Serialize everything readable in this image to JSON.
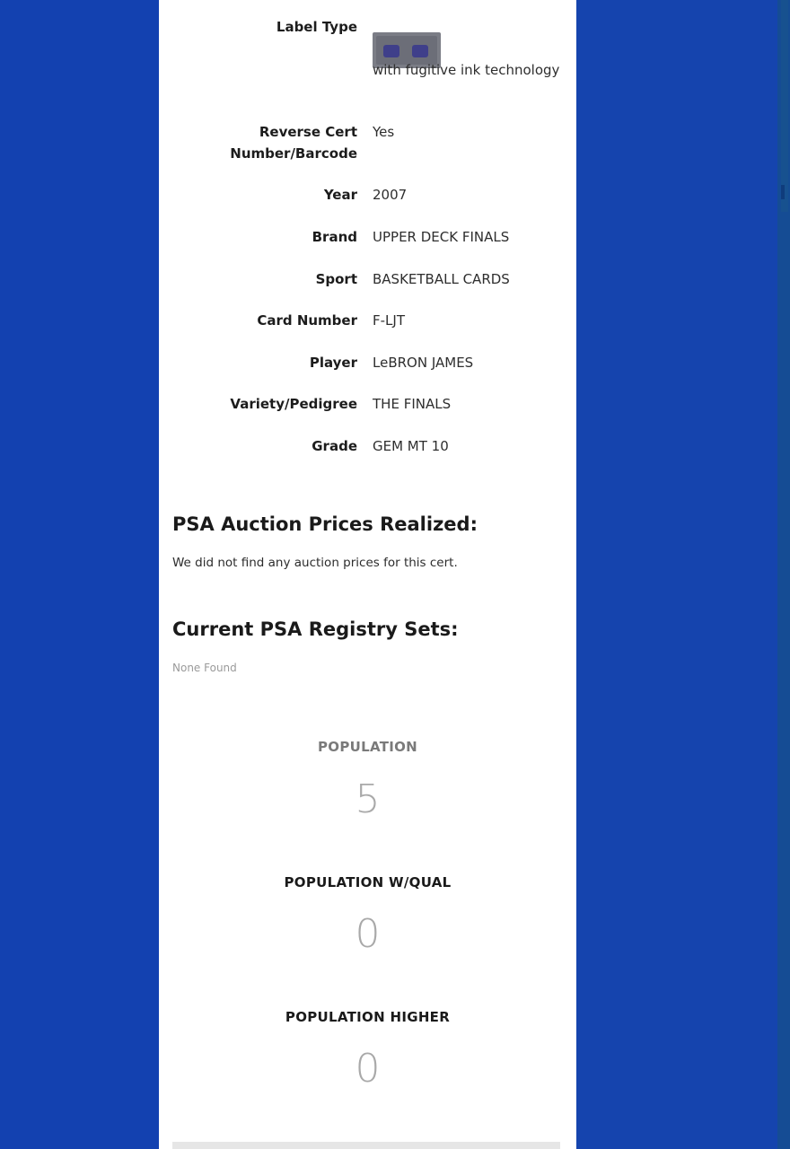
{
  "cert_details": [
    {
      "label": "Label Type",
      "value": "with fugitive ink technology"
    },
    {
      "label": "Reverse Cert Number/Barcode",
      "value": "Yes"
    },
    {
      "label": "Year",
      "value": "2007"
    },
    {
      "label": "Brand",
      "value": "UPPER DECK FINALS"
    },
    {
      "label": "Sport",
      "value": "BASKETBALL CARDS"
    },
    {
      "label": "Card Number",
      "value": "F-LJT"
    },
    {
      "label": "Player",
      "value": "LeBRON JAMES"
    },
    {
      "label": "Variety/Pedigree",
      "value": "THE FINALS"
    },
    {
      "label": "Grade",
      "value": "GEM MT 10"
    }
  ],
  "auction": {
    "heading": "PSA Auction Prices Realized:",
    "message": "We did not find any auction prices for this cert."
  },
  "registry": {
    "heading": "Current PSA Registry Sets:",
    "message": "None Found"
  },
  "population": {
    "label": "POPULATION",
    "value": "5"
  },
  "population_qual": {
    "label": "POPULATION W/QUAL",
    "value": "0"
  },
  "population_higher": {
    "label": "POPULATION HIGHER",
    "value": "0"
  },
  "colors": {
    "background": "#1341b0",
    "panel": "#ffffff",
    "badge": "#7b7d86"
  }
}
